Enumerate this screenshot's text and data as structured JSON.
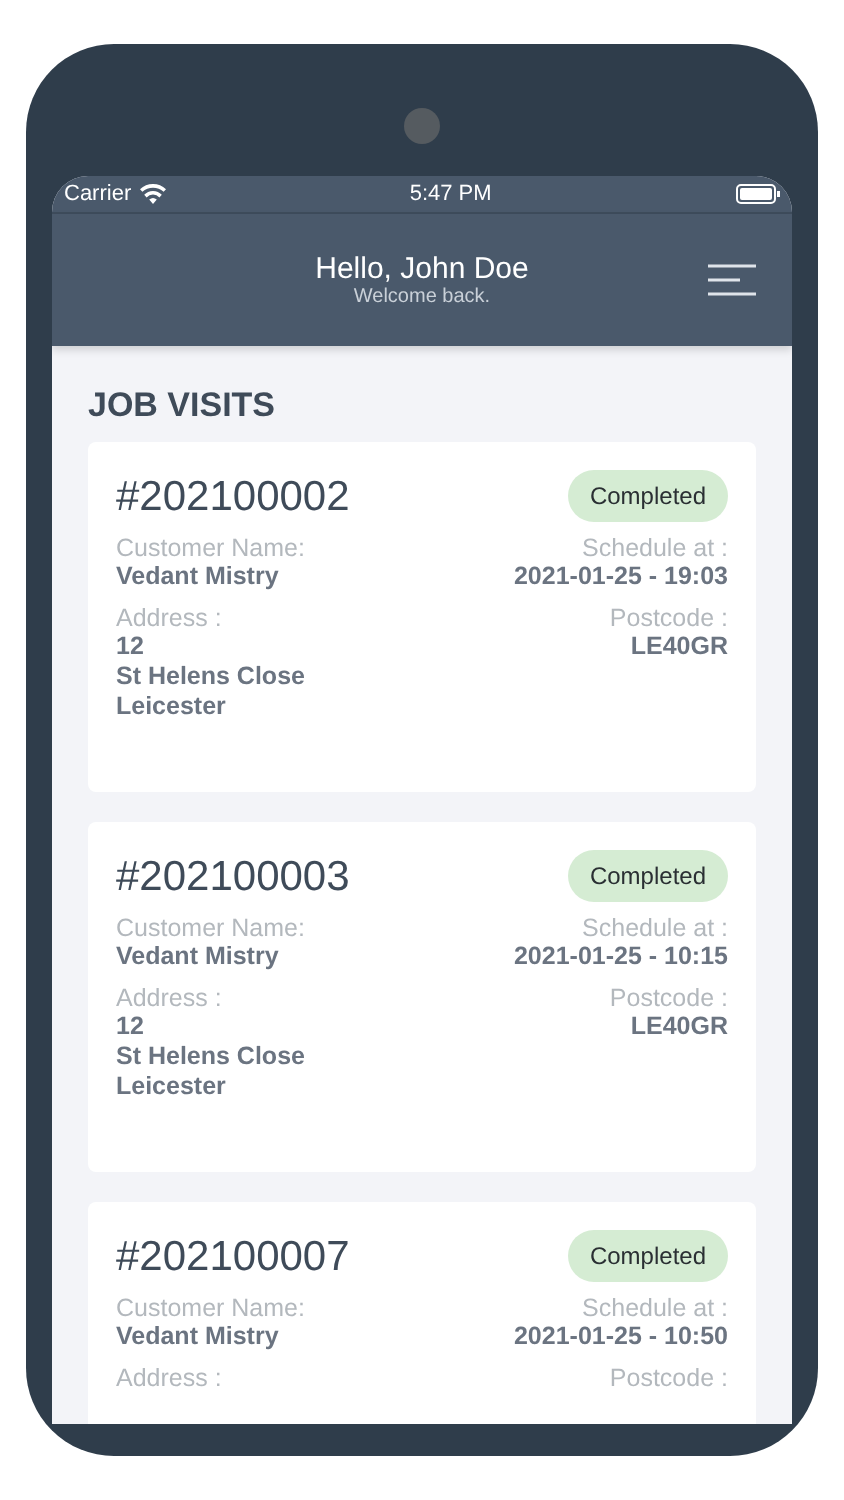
{
  "status_bar": {
    "carrier": "Carrier",
    "time": "5:47 PM"
  },
  "header": {
    "title": "Hello, John Doe",
    "subtitle": "Welcome back."
  },
  "section_title": "JOB VISITS",
  "jobs": [
    {
      "number": "#202100002",
      "status": "Completed",
      "customer_label": "Customer Name:",
      "customer": "Vedant Mistry",
      "schedule_label": "Schedule at :",
      "schedule": "2021-01-25 - 19:03",
      "address_label": "Address :",
      "address": [
        "12",
        "St Helens Close",
        "Leicester"
      ],
      "postcode_label": "Postcode :",
      "postcode": "LE40GR"
    },
    {
      "number": "#202100003",
      "status": "Completed",
      "customer_label": "Customer Name:",
      "customer": "Vedant Mistry",
      "schedule_label": "Schedule at :",
      "schedule": "2021-01-25 - 10:15",
      "address_label": "Address :",
      "address": [
        "12",
        "St Helens Close",
        "Leicester"
      ],
      "postcode_label": "Postcode :",
      "postcode": "LE40GR"
    },
    {
      "number": "#202100007",
      "status": "Completed",
      "customer_label": "Customer Name:",
      "customer": "Vedant Mistry",
      "schedule_label": "Schedule at :",
      "schedule": "2021-01-25 - 10:50",
      "address_label": "Address :",
      "postcode_label": "Postcode :"
    }
  ]
}
